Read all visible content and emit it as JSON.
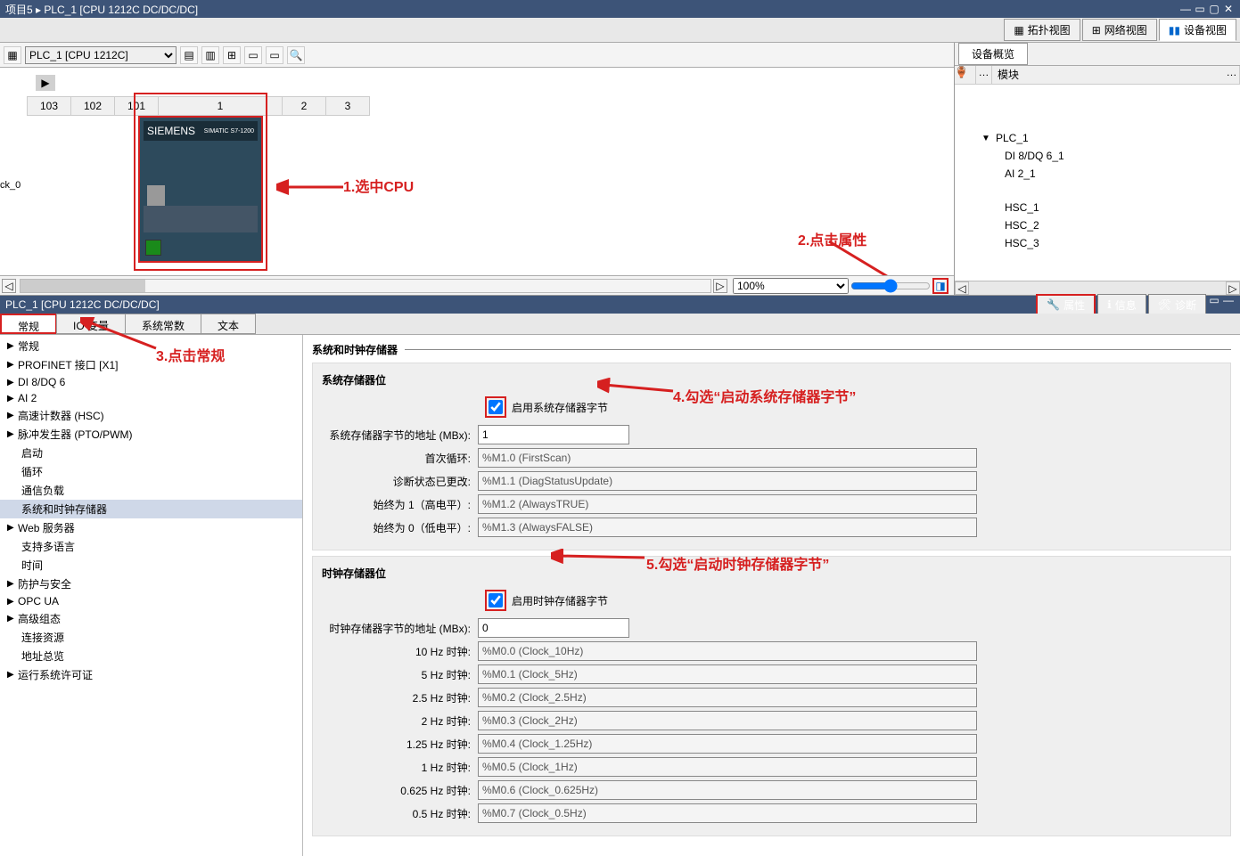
{
  "title_path": "项目5 ▸ PLC_1 [CPU 1212C DC/DC/DC]",
  "view_tabs": {
    "topo": "拓扑视图",
    "net": "网络视图",
    "dev": "设备视图"
  },
  "device_selector": "PLC_1 [CPU 1212C]",
  "slots": [
    "103",
    "102",
    "101",
    "1",
    "2",
    "3"
  ],
  "rack_label": "ck_0",
  "cpu_brand": "SIEMENS",
  "zoom": "100%",
  "note1": "1.选中CPU",
  "note2": "2.点击属性",
  "note3": "3.点击常规",
  "note4": "4.勾选“启动系统存储器字节”",
  "note5": "5.勾选“启动时钟存储器字节”",
  "overview_tab": "设备概览",
  "tree_col_module": "模块",
  "tree": {
    "plc": "PLC_1",
    "di": "DI 8/DQ 6_1",
    "ai": "AI 2_1",
    "hsc1": "HSC_1",
    "hsc2": "HSC_2",
    "hsc3": "HSC_3"
  },
  "inspector_title": "PLC_1 [CPU 1212C DC/DC/DC]",
  "prop_tabs": {
    "props": "属性",
    "info": "信息",
    "diag": "诊断"
  },
  "itabs": {
    "general": "常规",
    "io": "IO 变量",
    "sysconst": "系统常数",
    "text": "文本"
  },
  "nav": [
    {
      "l": "常规",
      "lvl": 1,
      "ar": "▶"
    },
    {
      "l": "PROFINET 接口 [X1]",
      "lvl": 1,
      "ar": "▶"
    },
    {
      "l": "DI 8/DQ 6",
      "lvl": 1,
      "ar": "▶"
    },
    {
      "l": "AI 2",
      "lvl": 1,
      "ar": "▶"
    },
    {
      "l": "高速计数器 (HSC)",
      "lvl": 1,
      "ar": "▶"
    },
    {
      "l": "脉冲发生器 (PTO/PWM)",
      "lvl": 1,
      "ar": "▶"
    },
    {
      "l": "启动",
      "lvl": 2,
      "ar": ""
    },
    {
      "l": "循环",
      "lvl": 2,
      "ar": ""
    },
    {
      "l": "通信负载",
      "lvl": 2,
      "ar": ""
    },
    {
      "l": "系统和时钟存储器",
      "lvl": 2,
      "ar": "",
      "sel": true
    },
    {
      "l": "Web 服务器",
      "lvl": 1,
      "ar": "▶"
    },
    {
      "l": "支持多语言",
      "lvl": 2,
      "ar": ""
    },
    {
      "l": "时间",
      "lvl": 2,
      "ar": ""
    },
    {
      "l": "防护与安全",
      "lvl": 1,
      "ar": "▶"
    },
    {
      "l": "OPC UA",
      "lvl": 1,
      "ar": "▶"
    },
    {
      "l": "高级组态",
      "lvl": 1,
      "ar": "▶"
    },
    {
      "l": "连接资源",
      "lvl": 2,
      "ar": ""
    },
    {
      "l": "地址总览",
      "lvl": 2,
      "ar": ""
    },
    {
      "l": "运行系统许可证",
      "lvl": 1,
      "ar": "▶"
    }
  ],
  "section1_title": "系统和时钟存储器",
  "sysmem": {
    "title": "系统存储器位",
    "chk": "启用系统存储器字节",
    "addr_l": "系统存储器字节的地址 (MBx):",
    "addr_v": "1",
    "first_l": "首次循环:",
    "first_v": "%M1.0 (FirstScan)",
    "diag_l": "诊断状态已更改:",
    "diag_v": "%M1.1 (DiagStatusUpdate)",
    "true_l": "始终为 1（高电平）:",
    "true_v": "%M1.2 (AlwaysTRUE)",
    "false_l": "始终为 0（低电平）:",
    "false_v": "%M1.3 (AlwaysFALSE)"
  },
  "clkmem": {
    "title": "时钟存储器位",
    "chk": "启用时钟存储器字节",
    "addr_l": "时钟存储器字节的地址 (MBx):",
    "addr_v": "0",
    "hz10_l": "10 Hz 时钟:",
    "hz10_v": "%M0.0 (Clock_10Hz)",
    "hz5_l": "5 Hz 时钟:",
    "hz5_v": "%M0.1 (Clock_5Hz)",
    "hz25_l": "2.5 Hz 时钟:",
    "hz25_v": "%M0.2 (Clock_2.5Hz)",
    "hz2_l": "2 Hz 时钟:",
    "hz2_v": "%M0.3 (Clock_2Hz)",
    "hz125_l": "1.25 Hz 时钟:",
    "hz125_v": "%M0.4 (Clock_1.25Hz)",
    "hz1_l": "1 Hz 时钟:",
    "hz1_v": "%M0.5 (Clock_1Hz)",
    "hz0625_l": "0.625 Hz 时钟:",
    "hz0625_v": "%M0.6 (Clock_0.625Hz)",
    "hz05_l": "0.5 Hz 时钟:",
    "hz05_v": "%M0.7 (Clock_0.5Hz)"
  }
}
